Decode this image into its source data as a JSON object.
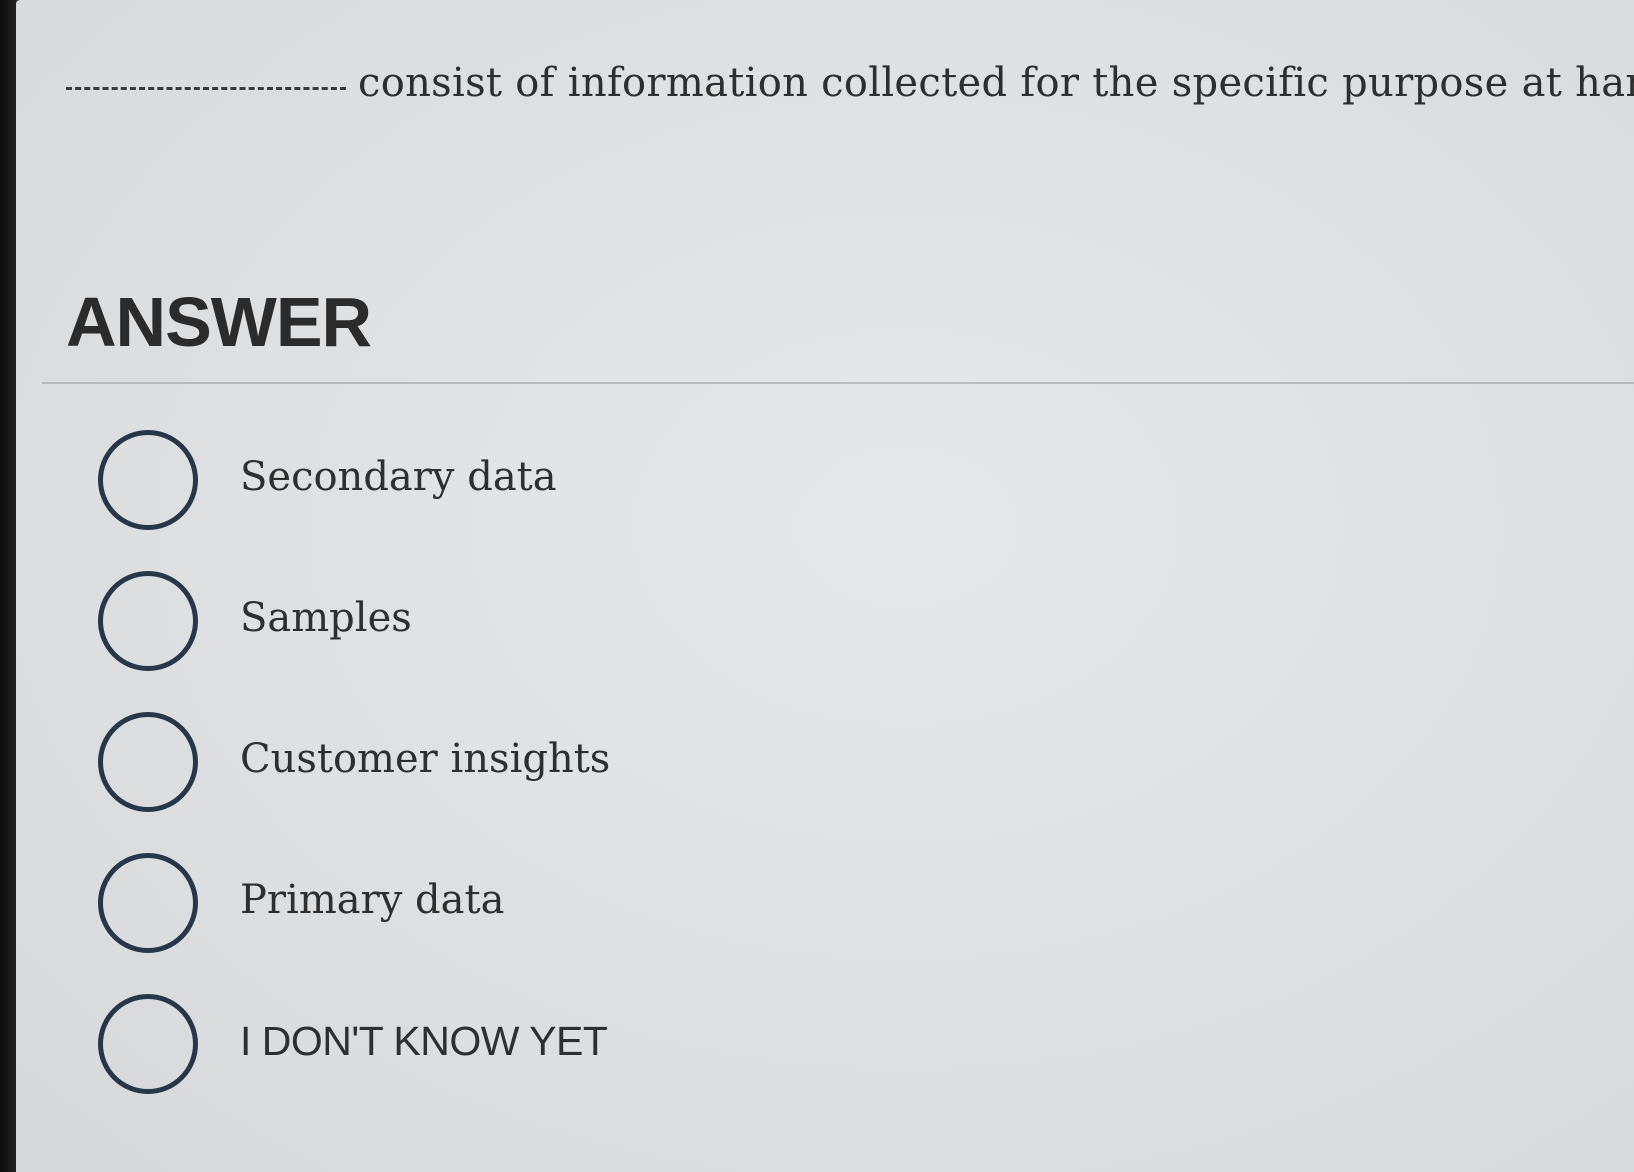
{
  "question": {
    "blank": "__________",
    "text": "consist of information collected for the specific purpose at hand."
  },
  "answer_heading": "ANSWER",
  "options": [
    {
      "label": "Secondary data",
      "selected": false
    },
    {
      "label": "Samples",
      "selected": false
    },
    {
      "label": "Customer insights",
      "selected": false
    },
    {
      "label": "Primary data",
      "selected": false
    },
    {
      "label": "I DON'T KNOW YET",
      "selected": false
    }
  ],
  "colors": {
    "radio_border": "#27374a",
    "text": "#2f2f2f",
    "background": "#e2e4e6"
  }
}
